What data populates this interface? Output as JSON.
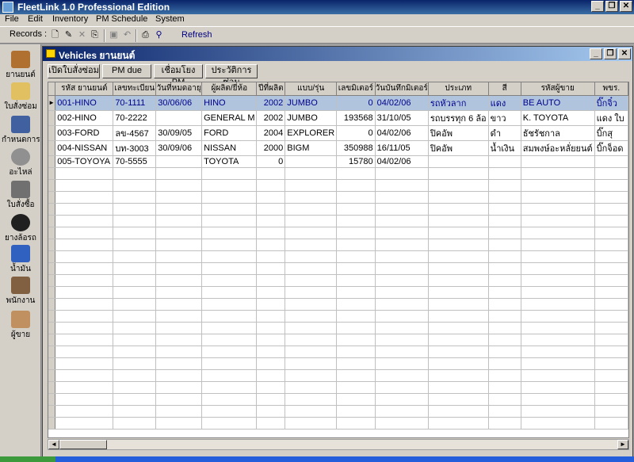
{
  "app": {
    "title": "FleetLink 1.0 Professional Edition"
  },
  "window_buttons": {
    "minimize": "_",
    "restore": "❐",
    "close": "✕"
  },
  "menu": [
    "File",
    "Edit",
    "Inventory",
    "PM Schedule",
    "System"
  ],
  "toolbar": {
    "records_label": "Records :",
    "refresh_label": "Refresh",
    "icons": [
      "new-icon",
      "edit-icon",
      "delete-icon",
      "copy-icon",
      "save-icon",
      "undo-icon",
      "print-icon",
      "find-icon"
    ]
  },
  "sidebar": [
    {
      "label": "ยานยนต์",
      "icon": "truck-icon",
      "color": "#b07030"
    },
    {
      "label": "ใบสั่งซ่อม",
      "icon": "repair-order-icon",
      "color": "#e0c060"
    },
    {
      "label": "กำหนดการ",
      "icon": "schedule-icon",
      "color": "#4060a0"
    },
    {
      "label": "อะไหล่",
      "icon": "parts-icon",
      "color": "#909090"
    },
    {
      "label": "ใบสั่งซื้อ",
      "icon": "purchase-order-icon",
      "color": "#707070"
    },
    {
      "label": "ยางล้อรถ",
      "icon": "tire-icon",
      "color": "#202020"
    },
    {
      "label": "น้ำมัน",
      "icon": "fuel-icon",
      "color": "#3060c0"
    },
    {
      "label": "พนักงาน",
      "icon": "staff-icon",
      "color": "#806040"
    },
    {
      "label": "ผู้ขาย",
      "icon": "vendor-icon",
      "color": "#c09060"
    }
  ],
  "child_window": {
    "title": "Vehicles ยานยนต์"
  },
  "tabs": [
    "เปิดใบสั่งซ่อม",
    "PM due",
    "เชื่อมโยง PM",
    "ประวัติการซ่อม"
  ],
  "grid": {
    "columns": [
      "รหัส ยานยนต์",
      "เลขทะเบียน",
      "วันที่หมดอายุ",
      "ผู้ผลิต/ยี่ห้อ",
      "ปีที่ผลิต",
      "แบบ/รุ่น",
      "เลขมิเตอร์",
      "วันบันทึกมิเตอร์",
      "ประเภท",
      "สี",
      "รหัสผู้ขาย",
      "พขร."
    ],
    "rows": [
      [
        "001-HINO",
        "70-1111",
        "30/06/06",
        "HINO",
        "2002",
        "JUMBO",
        "0",
        "04/02/06",
        "รถหัวลาก",
        "แดง",
        "BE AUTO",
        "บิ๊กจิ๋ว"
      ],
      [
        "002-HINO",
        "70-2222",
        "",
        "GENERAL M",
        "2002",
        "JUMBO",
        "193568",
        "31/10/05",
        "รถบรรทุก 6 ล้อ",
        "ขาว",
        "K. TOYOTA",
        "แดง ใบ"
      ],
      [
        "003-FORD",
        "ลข-4567",
        "30/09/05",
        "FORD",
        "2004",
        "EXPLORER",
        "0",
        "04/02/06",
        "ปิคอัพ",
        "ดำ",
        "ธัชรัชกาล",
        "บิ๊กสุ"
      ],
      [
        "004-NISSAN",
        "บท-3003",
        "30/09/06",
        "NISSAN",
        "2000",
        "BIGM",
        "350988",
        "16/11/05",
        "ปิคอัพ",
        "น้ำเงิน",
        "สมพงษ์อะหลั่ยยนต์",
        "บิ๊กจ็อด"
      ],
      [
        "005-TOYOYA",
        "70-5555",
        "",
        "TOYOTA",
        "0",
        "",
        "15780",
        "04/02/06",
        "",
        "",
        "",
        ""
      ]
    ],
    "selected_index": 0,
    "row_indicator": "►"
  }
}
